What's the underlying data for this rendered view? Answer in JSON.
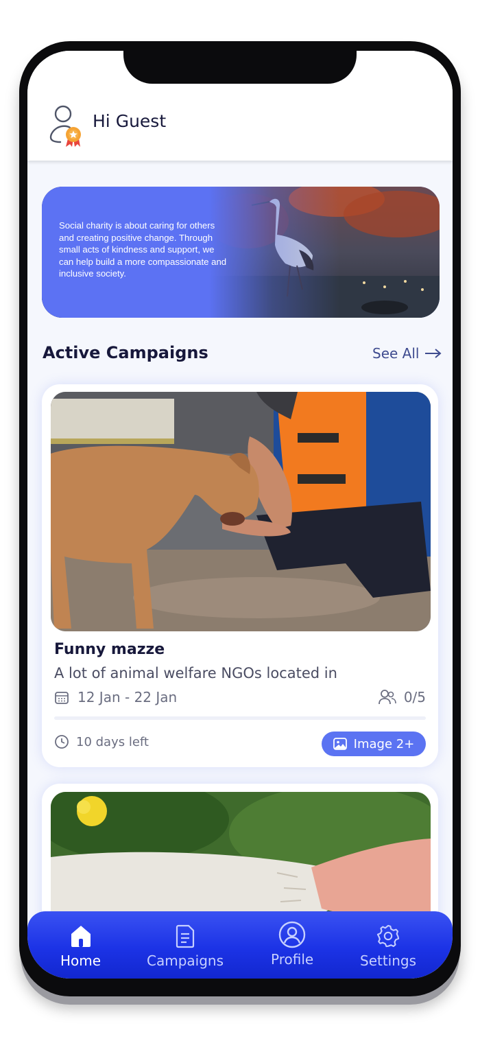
{
  "header": {
    "greeting": "Hi Guest",
    "avatar_icon": "user-badge-icon"
  },
  "banner": {
    "text": "Social charity is about caring for others and creating positive change. Through small acts of kindness and support, we can help build a more compassionate and inclusive society."
  },
  "section": {
    "title": "Active Campaigns",
    "see_all": "See All",
    "see_all_icon": "arrow-right-icon"
  },
  "campaign": {
    "title": "Funny mazze",
    "description": "A lot of animal welfare NGOs located in",
    "date_range": "12 Jan - 22 Jan",
    "participants": "0/5",
    "progress": 0,
    "days_left": "10 days left",
    "image_button": "Image 2+"
  },
  "nav": {
    "items": [
      {
        "label": "Home",
        "icon": "home-icon",
        "active": true
      },
      {
        "label": "Campaigns",
        "icon": "document-icon",
        "active": false
      },
      {
        "label": "Profile",
        "icon": "profile-icon",
        "active": false
      },
      {
        "label": "Settings",
        "icon": "gear-icon",
        "active": false
      }
    ]
  },
  "colors": {
    "accent": "#5b73f2",
    "nav": "#1c33e6",
    "text": "#17183b"
  }
}
